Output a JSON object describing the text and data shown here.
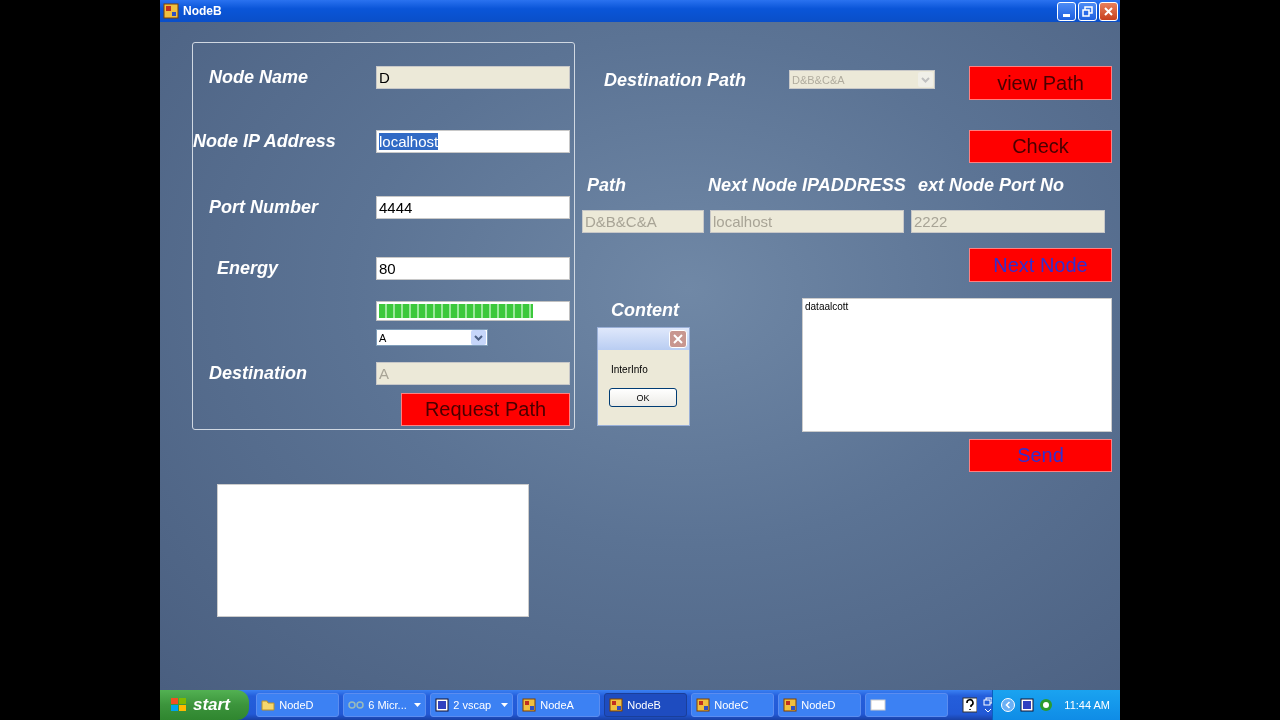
{
  "window": {
    "title": "NodeB"
  },
  "node_panel": {
    "fields": [
      {
        "label": "Node Name",
        "value": "D",
        "kind": "readonly",
        "selected_text": false
      },
      {
        "label": "Node IP Address",
        "value": "localhost",
        "kind": "editable",
        "selected_text": true
      },
      {
        "label": "Port Number",
        "value": "4444",
        "kind": "editable",
        "selected_text": false
      },
      {
        "label": "Energy",
        "value": "80",
        "kind": "editable",
        "selected_text": false
      }
    ],
    "energy_bar": {
      "level": 0.82
    },
    "destination": {
      "label": "Destination",
      "combo_value": "A",
      "field_value": "A",
      "field_disabled": true
    },
    "request_button": {
      "label": "Request Path",
      "kind": "dark"
    }
  },
  "route": {
    "destination_path_label": "Destination Path",
    "destination_path_value": "D&B&C&A",
    "view_path_button": {
      "label": "view Path",
      "kind": "dark"
    },
    "check_button": {
      "label": "Check",
      "kind": "dark"
    },
    "columns": [
      {
        "label": "Path",
        "value": "D&B&C&A",
        "kind": "disabled"
      },
      {
        "label": "Next Node IPADDRESS",
        "value": "localhost",
        "kind": "disabled"
      },
      {
        "label": "ext Node Port No",
        "value": "2222",
        "kind": "disabled"
      }
    ],
    "next_node_button": {
      "label": "Next Node",
      "kind": "blue"
    }
  },
  "content": {
    "label": "Content",
    "text": "dataalcott",
    "send_button": {
      "label": "Send",
      "kind": "blue"
    }
  },
  "dialog": {
    "message": "InterInfo",
    "ok_button": "OK"
  },
  "taskbar": {
    "start": "start",
    "items": [
      {
        "label": "NodeD",
        "kind": "folder",
        "selected": false,
        "grouped": false
      },
      {
        "label": "6 Micr...",
        "kind": "glasses",
        "selected": false,
        "grouped": true
      },
      {
        "label": "2 vscap",
        "kind": "app",
        "selected": false,
        "grouped": true
      },
      {
        "label": "NodeA",
        "kind": "form",
        "selected": false,
        "grouped": false
      },
      {
        "label": "NodeB",
        "kind": "form",
        "selected": true,
        "grouped": false
      },
      {
        "label": "NodeC",
        "kind": "form",
        "selected": false,
        "grouped": false
      },
      {
        "label": "NodeD",
        "kind": "form",
        "selected": false,
        "grouped": false
      },
      {
        "kind": "blank",
        "selected": false,
        "grouped": false
      }
    ],
    "clock": "11:44 AM"
  }
}
